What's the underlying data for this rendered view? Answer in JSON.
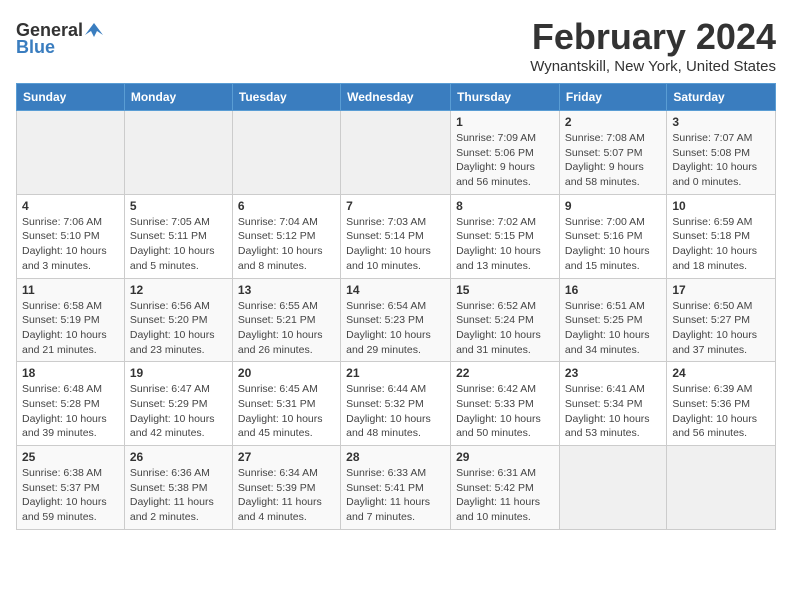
{
  "header": {
    "logo_general": "General",
    "logo_blue": "Blue",
    "month_title": "February 2024",
    "location": "Wynantskill, New York, United States"
  },
  "weekdays": [
    "Sunday",
    "Monday",
    "Tuesday",
    "Wednesday",
    "Thursday",
    "Friday",
    "Saturday"
  ],
  "weeks": [
    [
      {
        "day": "",
        "sunrise": "",
        "sunset": "",
        "daylight": "",
        "empty": true
      },
      {
        "day": "",
        "sunrise": "",
        "sunset": "",
        "daylight": "",
        "empty": true
      },
      {
        "day": "",
        "sunrise": "",
        "sunset": "",
        "daylight": "",
        "empty": true
      },
      {
        "day": "",
        "sunrise": "",
        "sunset": "",
        "daylight": "",
        "empty": true
      },
      {
        "day": "1",
        "sunrise": "Sunrise: 7:09 AM",
        "sunset": "Sunset: 5:06 PM",
        "daylight": "Daylight: 9 hours and 56 minutes.",
        "empty": false
      },
      {
        "day": "2",
        "sunrise": "Sunrise: 7:08 AM",
        "sunset": "Sunset: 5:07 PM",
        "daylight": "Daylight: 9 hours and 58 minutes.",
        "empty": false
      },
      {
        "day": "3",
        "sunrise": "Sunrise: 7:07 AM",
        "sunset": "Sunset: 5:08 PM",
        "daylight": "Daylight: 10 hours and 0 minutes.",
        "empty": false
      }
    ],
    [
      {
        "day": "4",
        "sunrise": "Sunrise: 7:06 AM",
        "sunset": "Sunset: 5:10 PM",
        "daylight": "Daylight: 10 hours and 3 minutes.",
        "empty": false
      },
      {
        "day": "5",
        "sunrise": "Sunrise: 7:05 AM",
        "sunset": "Sunset: 5:11 PM",
        "daylight": "Daylight: 10 hours and 5 minutes.",
        "empty": false
      },
      {
        "day": "6",
        "sunrise": "Sunrise: 7:04 AM",
        "sunset": "Sunset: 5:12 PM",
        "daylight": "Daylight: 10 hours and 8 minutes.",
        "empty": false
      },
      {
        "day": "7",
        "sunrise": "Sunrise: 7:03 AM",
        "sunset": "Sunset: 5:14 PM",
        "daylight": "Daylight: 10 hours and 10 minutes.",
        "empty": false
      },
      {
        "day": "8",
        "sunrise": "Sunrise: 7:02 AM",
        "sunset": "Sunset: 5:15 PM",
        "daylight": "Daylight: 10 hours and 13 minutes.",
        "empty": false
      },
      {
        "day": "9",
        "sunrise": "Sunrise: 7:00 AM",
        "sunset": "Sunset: 5:16 PM",
        "daylight": "Daylight: 10 hours and 15 minutes.",
        "empty": false
      },
      {
        "day": "10",
        "sunrise": "Sunrise: 6:59 AM",
        "sunset": "Sunset: 5:18 PM",
        "daylight": "Daylight: 10 hours and 18 minutes.",
        "empty": false
      }
    ],
    [
      {
        "day": "11",
        "sunrise": "Sunrise: 6:58 AM",
        "sunset": "Sunset: 5:19 PM",
        "daylight": "Daylight: 10 hours and 21 minutes.",
        "empty": false
      },
      {
        "day": "12",
        "sunrise": "Sunrise: 6:56 AM",
        "sunset": "Sunset: 5:20 PM",
        "daylight": "Daylight: 10 hours and 23 minutes.",
        "empty": false
      },
      {
        "day": "13",
        "sunrise": "Sunrise: 6:55 AM",
        "sunset": "Sunset: 5:21 PM",
        "daylight": "Daylight: 10 hours and 26 minutes.",
        "empty": false
      },
      {
        "day": "14",
        "sunrise": "Sunrise: 6:54 AM",
        "sunset": "Sunset: 5:23 PM",
        "daylight": "Daylight: 10 hours and 29 minutes.",
        "empty": false
      },
      {
        "day": "15",
        "sunrise": "Sunrise: 6:52 AM",
        "sunset": "Sunset: 5:24 PM",
        "daylight": "Daylight: 10 hours and 31 minutes.",
        "empty": false
      },
      {
        "day": "16",
        "sunrise": "Sunrise: 6:51 AM",
        "sunset": "Sunset: 5:25 PM",
        "daylight": "Daylight: 10 hours and 34 minutes.",
        "empty": false
      },
      {
        "day": "17",
        "sunrise": "Sunrise: 6:50 AM",
        "sunset": "Sunset: 5:27 PM",
        "daylight": "Daylight: 10 hours and 37 minutes.",
        "empty": false
      }
    ],
    [
      {
        "day": "18",
        "sunrise": "Sunrise: 6:48 AM",
        "sunset": "Sunset: 5:28 PM",
        "daylight": "Daylight: 10 hours and 39 minutes.",
        "empty": false
      },
      {
        "day": "19",
        "sunrise": "Sunrise: 6:47 AM",
        "sunset": "Sunset: 5:29 PM",
        "daylight": "Daylight: 10 hours and 42 minutes.",
        "empty": false
      },
      {
        "day": "20",
        "sunrise": "Sunrise: 6:45 AM",
        "sunset": "Sunset: 5:31 PM",
        "daylight": "Daylight: 10 hours and 45 minutes.",
        "empty": false
      },
      {
        "day": "21",
        "sunrise": "Sunrise: 6:44 AM",
        "sunset": "Sunset: 5:32 PM",
        "daylight": "Daylight: 10 hours and 48 minutes.",
        "empty": false
      },
      {
        "day": "22",
        "sunrise": "Sunrise: 6:42 AM",
        "sunset": "Sunset: 5:33 PM",
        "daylight": "Daylight: 10 hours and 50 minutes.",
        "empty": false
      },
      {
        "day": "23",
        "sunrise": "Sunrise: 6:41 AM",
        "sunset": "Sunset: 5:34 PM",
        "daylight": "Daylight: 10 hours and 53 minutes.",
        "empty": false
      },
      {
        "day": "24",
        "sunrise": "Sunrise: 6:39 AM",
        "sunset": "Sunset: 5:36 PM",
        "daylight": "Daylight: 10 hours and 56 minutes.",
        "empty": false
      }
    ],
    [
      {
        "day": "25",
        "sunrise": "Sunrise: 6:38 AM",
        "sunset": "Sunset: 5:37 PM",
        "daylight": "Daylight: 10 hours and 59 minutes.",
        "empty": false
      },
      {
        "day": "26",
        "sunrise": "Sunrise: 6:36 AM",
        "sunset": "Sunset: 5:38 PM",
        "daylight": "Daylight: 11 hours and 2 minutes.",
        "empty": false
      },
      {
        "day": "27",
        "sunrise": "Sunrise: 6:34 AM",
        "sunset": "Sunset: 5:39 PM",
        "daylight": "Daylight: 11 hours and 4 minutes.",
        "empty": false
      },
      {
        "day": "28",
        "sunrise": "Sunrise: 6:33 AM",
        "sunset": "Sunset: 5:41 PM",
        "daylight": "Daylight: 11 hours and 7 minutes.",
        "empty": false
      },
      {
        "day": "29",
        "sunrise": "Sunrise: 6:31 AM",
        "sunset": "Sunset: 5:42 PM",
        "daylight": "Daylight: 11 hours and 10 minutes.",
        "empty": false
      },
      {
        "day": "",
        "sunrise": "",
        "sunset": "",
        "daylight": "",
        "empty": true
      },
      {
        "day": "",
        "sunrise": "",
        "sunset": "",
        "daylight": "",
        "empty": true
      }
    ]
  ]
}
